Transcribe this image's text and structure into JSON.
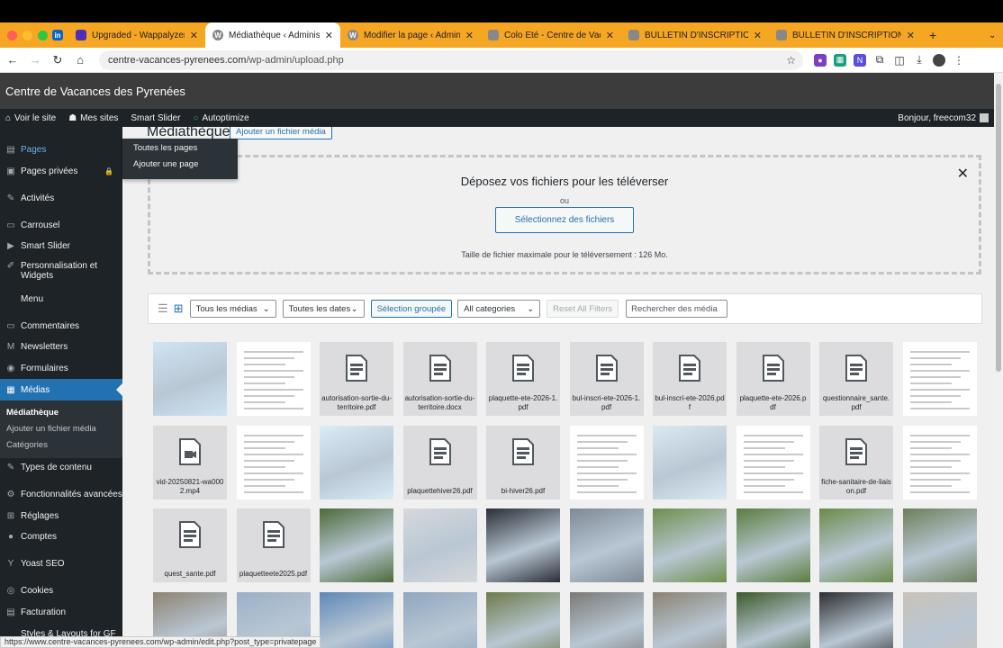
{
  "browser": {
    "tabs": [
      {
        "title": "",
        "favicon": "linkedin-icon",
        "color": "#0a66c2"
      },
      {
        "title": "Upgraded - Wappalyzer",
        "favicon": "wappalyzer-icon",
        "color": "#4b2fb5"
      },
      {
        "title": "Médiathèque ‹ Administration",
        "favicon": "wordpress-icon",
        "color": "#888"
      },
      {
        "title": "Modifier la page ‹ Administration",
        "favicon": "wordpress-icon",
        "color": "#888"
      },
      {
        "title": "Colo Eté - Centre de Vacances",
        "favicon": "site-icon",
        "color": "#888"
      },
      {
        "title": "BULLETIN D'INSCRIPTION",
        "favicon": "site-icon",
        "color": "#888"
      },
      {
        "title": "BULLETIN D'INSCRIPTION",
        "favicon": "site-icon",
        "color": "#888"
      }
    ],
    "url_host": "centre-vacances-pyrenees.com",
    "url_path": "/wp-admin/upload.php",
    "status_url": "https://www.centre-vacances-pyrenees.com/wp-admin/edit.php?post_type=privatepage"
  },
  "header": {
    "site_title": "Centre de Vacances des Pyrenées"
  },
  "adminbar": {
    "view_site": "Voir le site",
    "my_sites": "Mes sites",
    "smart_slider": "Smart Slider",
    "autoptimize": "Autoptimize",
    "greeting": "Bonjour, freecom32"
  },
  "sidebar": {
    "items": [
      "Pages",
      "Pages privées",
      "Activités",
      "Carrousel",
      "Smart Slider",
      "Personnalisation et",
      "Menu",
      "Commentaires",
      "Newsletters",
      "Formulaires",
      "Médias",
      "Types de contenu",
      "Fonctionnalités avancées",
      "Réglages",
      "Comptes",
      "Yoast SEO",
      "Cookies",
      "Facturation",
      "Styles & Layouts for GF"
    ],
    "personnalisation_line2": "Widgets",
    "medias_sub": [
      "Médiathèque",
      "Ajouter un fichier média",
      "Catégories"
    ],
    "pages_flyout": [
      "Toutes les pages",
      "Ajouter une page"
    ]
  },
  "main": {
    "title": "Médiathèque",
    "add_button": "Ajouter un fichier média",
    "drop_heading": "Déposez vos fichiers pour les téléverser",
    "drop_or": "ou",
    "select_files": "Sélectionnez des fichiers",
    "max_size": "Taille de fichier maximale pour le téléversement : 126 Mo.",
    "filters": {
      "media_type": "Tous les médias",
      "dates": "Toutes les dates",
      "bulk": "Sélection groupée",
      "categories": "All categories",
      "reset": "Reset All Filters",
      "search_placeholder": "Rechercher des média"
    },
    "files": [
      "autorisation-sortie-du-territoire.pdf",
      "autorisation-sortie-du-territoire.docx",
      "plaquette-ete-2026-1.pdf",
      "bul-inscri-ete-2026-1.pdf",
      "bul-inscri-ete-2026.pdf",
      "plaquette-ete-2026.pdf",
      "questionnaire_sante.pdf",
      "vid-20250821-wa0002.mp4",
      "plaquettehiver26.pdf",
      "bi-hiver26.pdf",
      "fiche-sanitaire-de-liaison.pdf",
      "quest_sante.pdf",
      "plaquetteete2025.pdf"
    ]
  }
}
